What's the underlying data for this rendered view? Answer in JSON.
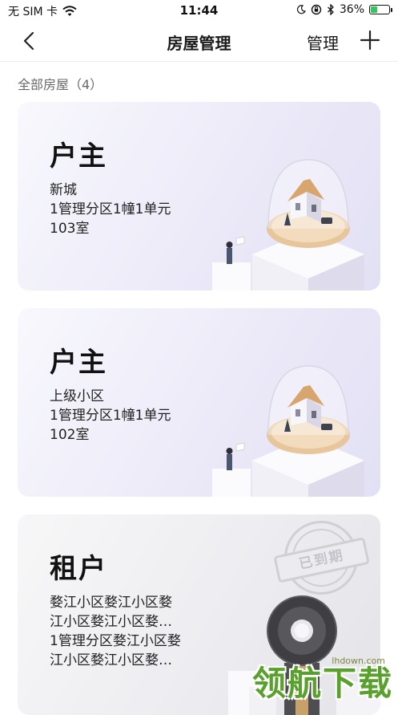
{
  "status_bar": {
    "carrier": "无 SIM 卡",
    "time": "11:44",
    "battery_percent": "36%",
    "battery_level": 0.36,
    "battery_color": "#35c759"
  },
  "nav": {
    "title": "房屋管理",
    "manage_label": "管理",
    "back_icon": "chevron-left-icon",
    "add_icon": "plus-icon"
  },
  "section": {
    "title": "全部房屋（4）"
  },
  "houses": [
    {
      "role": "户主",
      "lines": [
        "新城",
        "1管理分区1幢1单元",
        "103室"
      ]
    },
    {
      "role": "户主",
      "lines": [
        "上级小区",
        "1管理分区1幢1单元",
        "102室"
      ]
    },
    {
      "role": "租户",
      "lines": [
        "婺江小区婺江小区婺",
        "江小区婺江小区婺…",
        "1管理分区婺江小区婺",
        "江小区婺江小区婺…"
      ],
      "stamp": "已到期"
    }
  ],
  "watermark": {
    "site": "lhdown.com",
    "text": "领航下载"
  }
}
